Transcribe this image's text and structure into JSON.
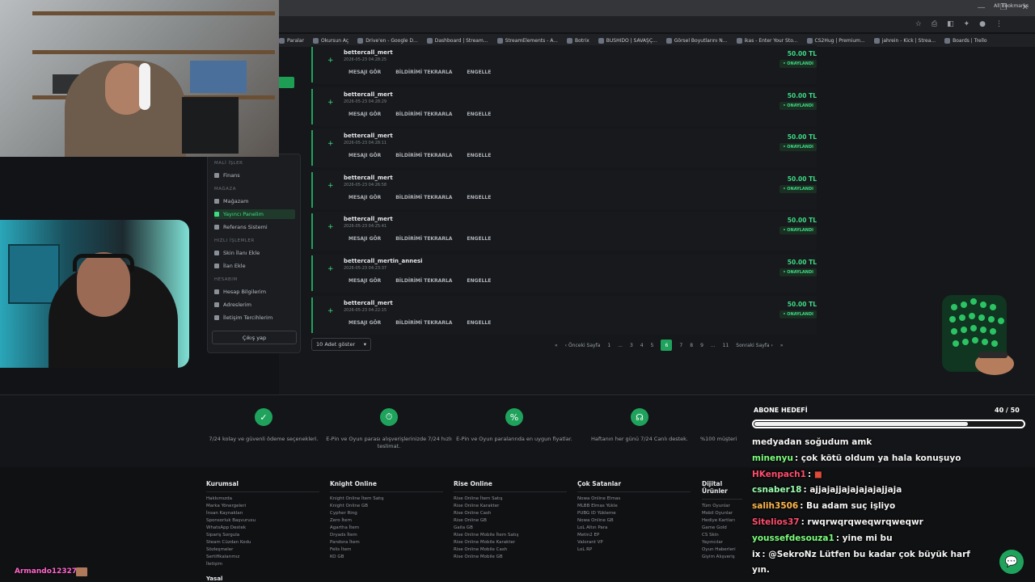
{
  "bookmarks": [
    {
      "label": "Paralar"
    },
    {
      "label": "Okursun Aç"
    },
    {
      "label": "Drive'en - Google D..."
    },
    {
      "label": "Dashboard | Stream..."
    },
    {
      "label": "StreamElements - A..."
    },
    {
      "label": "Botrix"
    },
    {
      "label": "BUSHIDO | SAVAŞÇ..."
    },
    {
      "label": "Görsel Boyutlarını N..."
    },
    {
      "label": "ikas - Enter Your Sto..."
    },
    {
      "label": "CS2Hug | Premium..."
    },
    {
      "label": "jahrein - Kick | Strea..."
    },
    {
      "label": "Boards | Trello"
    }
  ],
  "all_bookmarks": "All Bookmarks",
  "sidebar": {
    "sections": [
      {
        "title": "MALİ İŞLER",
        "items": [
          {
            "label": "Finans"
          }
        ]
      },
      {
        "title": "MAĞAZA",
        "items": [
          {
            "label": "Mağazam"
          },
          {
            "label": "Yayıncı Panelim",
            "active": true
          },
          {
            "label": "Referans Sistemi"
          }
        ]
      },
      {
        "title": "HIZLI İŞLEMLER",
        "items": [
          {
            "label": "Skin İlanı Ekle"
          },
          {
            "label": "İlan Ekle"
          }
        ]
      },
      {
        "title": "HESABIM",
        "items": [
          {
            "label": "Hesap Bilgilerim"
          },
          {
            "label": "Adreslerim"
          },
          {
            "label": "İletişim Tercihlerim"
          }
        ]
      }
    ],
    "logout": "Çıkış yap"
  },
  "rows": [
    {
      "user": "bettercall_mert",
      "date": "2026-05-23 04:28:25",
      "amount": "50.00 TL",
      "status": "• ONAYLANDI"
    },
    {
      "user": "bettercall_mert",
      "date": "2026-05-23 04:28:29",
      "amount": "50.00 TL",
      "status": "• ONAYLANDI"
    },
    {
      "user": "bettercall_mert",
      "date": "2026-05-23 04:28:11",
      "amount": "50.00 TL",
      "status": "• ONAYLANDI"
    },
    {
      "user": "bettercall_mert",
      "date": "2026-05-23 04:26:58",
      "amount": "50.00 TL",
      "status": "• ONAYLANDI"
    },
    {
      "user": "bettercall_mert",
      "date": "2026-05-23 04:25:41",
      "amount": "50.00 TL",
      "status": "• ONAYLANDI"
    },
    {
      "user": "bettercall_mertin_annesi",
      "date": "2026-05-23 04:23:37",
      "amount": "50.00 TL",
      "status": "• ONAYLANDI"
    },
    {
      "user": "bettercall_mert",
      "date": "2026-05-23 04:22:15",
      "amount": "50.00 TL",
      "status": "• ONAYLANDI"
    }
  ],
  "row_actions": {
    "view": "MESAJI GÖR",
    "replay": "BİLDİRİMİ TEKRARLA",
    "block": "ENGELLE"
  },
  "per_page": "10 Adet göster",
  "pager": {
    "first": "«",
    "prev": "‹ Önceki Sayfa",
    "pages": [
      "1",
      "...",
      "3",
      "4",
      "5",
      "6",
      "7",
      "8",
      "9",
      "...",
      "11"
    ],
    "current": "6",
    "next": "Sonraki Sayfa ›",
    "last": "»"
  },
  "features": [
    {
      "icon": "shield-check-icon",
      "glyph": "✓",
      "text": "7/24 kolay ve güvenli ödeme seçenekleri."
    },
    {
      "icon": "stopwatch-icon",
      "glyph": "⏱",
      "text": "E-Pin ve Oyun parası alışverişlerinizde 7/24 hızlı teslimat."
    },
    {
      "icon": "percent-icon",
      "glyph": "%",
      "text": "E-Pin ve Oyun paralarında en uygun fiyatlar."
    },
    {
      "icon": "headset-icon",
      "glyph": "☊",
      "text": "Haftanın her günü 7/24 Canlı destek."
    },
    {
      "icon": "badge-icon",
      "glyph": "★",
      "text": "%100 müşteri"
    }
  ],
  "footer": [
    {
      "title": "Kurumsal",
      "links": [
        "Hakkımızda",
        "Marka Yönergeleri",
        "İnsan Kaynakları",
        "Sponsorluk Başvurusu",
        "WhatsApp Destek",
        "Sipariş Sorgula",
        "Steam Cüzdan Kodu",
        "Sözleşmeler",
        "Sertifikalarımız",
        "İletişim"
      ]
    },
    {
      "title": "Knight Online",
      "links": [
        "Knight Online İtem Satış",
        "Knight Online GB",
        "Cypher Ring",
        "Zero İtem",
        "Agartha İtem",
        "Dryads İtem",
        "Pandora İtem",
        "Felis İtem",
        "KO GB"
      ]
    },
    {
      "title": "Rise Online",
      "links": [
        "Rise Online İtem Satış",
        "Rise Online Karakter",
        "Rise Online Cash",
        "Rise Online GB",
        "Gaila GB",
        "Rise Online Mobile İtem Satış",
        "Rise Online Mobile Karakter",
        "Rise Online Mobile Cash",
        "Rise Online Mobile GB"
      ]
    },
    {
      "title": "Çok Satanlar",
      "links": [
        "Nowa Online Elmas",
        "MLBB Elmas Yükle",
        "PUBG ID Yükleme",
        "Nowa Online GB",
        "LoL Altın Para",
        "Metin2 EP",
        "Valorant VP",
        "LoL RP"
      ]
    },
    {
      "title": "Dijital Ürünler",
      "links": [
        "Tüm Oyunlar",
        "Mobil Oyunlar",
        "Hediye Kartları",
        "Game Gold",
        "CS Skin",
        "Yayıncılar",
        "Oyun Haberleri",
        "Giyim Alışveriş"
      ]
    }
  ],
  "footer_more": "Yasal",
  "sub_goal": {
    "label": "ABONE HEDEFİ",
    "count": "40 / 50",
    "progress": 0.8
  },
  "chat": [
    {
      "user": "",
      "color": "#ffffff",
      "text": "medyadan soğudum amk"
    },
    {
      "user": "minenyu",
      "color": "#7cff7c",
      "text": ": çok kötü oldum ya hala konuşuyo"
    },
    {
      "user": "HKenpach1",
      "color": "#ff4d6d",
      "text": ": "
    },
    {
      "user": "csnaber18",
      "color": "#9cffb0",
      "text": ": ajjajajjajajajajajjaja"
    },
    {
      "user": "salih3506",
      "color": "#ffb84d",
      "text": ": Bu adam suç işliyo"
    },
    {
      "user": "Sitelios37",
      "color": "#ff4d6d",
      "text": ": rwqrwqrqweqwrqweqwr"
    },
    {
      "user": "youssefdesouza1",
      "color": "#7cff7c",
      "text": ": yine mi bu"
    },
    {
      "user": "ix",
      "color": "#ffffff",
      "text": ": @SekroNz Lütfen bu kadar çok büyük harf"
    },
    {
      "user": "",
      "color": "#ffffff",
      "text": "yın."
    }
  ],
  "overlay_user": "Armando12327"
}
